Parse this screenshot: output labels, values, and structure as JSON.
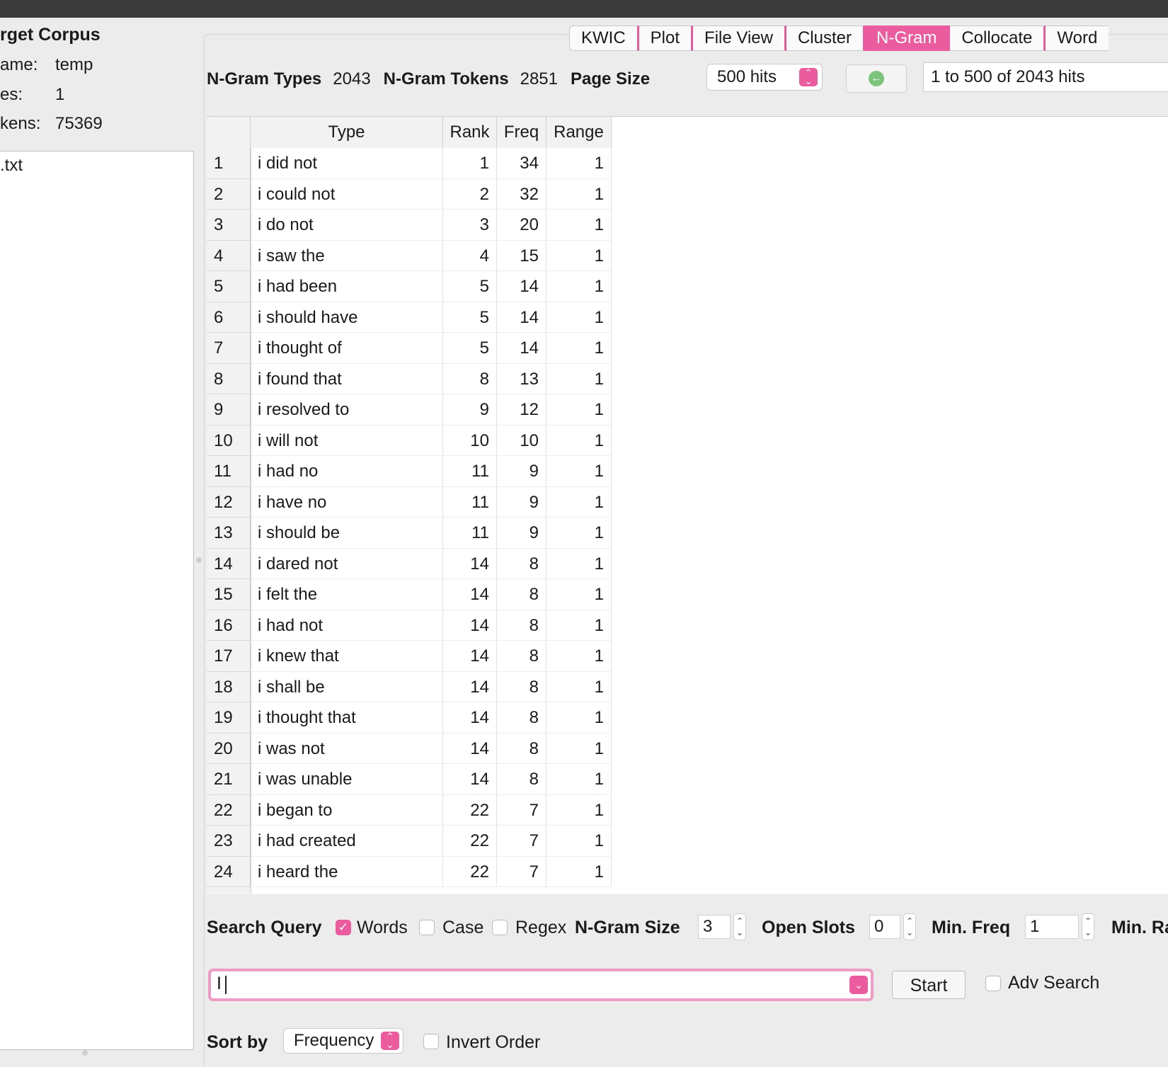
{
  "left_panel": {
    "title": "rget Corpus",
    "name_label": "ame:",
    "name_value": "temp",
    "files_label": "es:",
    "files_value": "1",
    "tokens_label": "kens:",
    "tokens_value": "75369",
    "files": [
      ".txt"
    ]
  },
  "tabs": [
    "KWIC",
    "Plot",
    "File View",
    "Cluster",
    "N-Gram",
    "Collocate",
    "Word"
  ],
  "active_tab": "N-Gram",
  "stats": {
    "types_label": "N-Gram Types",
    "types_value": "2043",
    "tokens_label": "N-Gram Tokens",
    "tokens_value": "2851",
    "page_size_label": "Page Size",
    "page_size_value": "500 hits",
    "range_text": "1 to 500 of 2043 hits"
  },
  "table": {
    "headers": [
      "Type",
      "Rank",
      "Freq",
      "Range"
    ],
    "rows": [
      [
        "1",
        "i did not",
        "1",
        "34",
        "1"
      ],
      [
        "2",
        "i could not",
        "2",
        "32",
        "1"
      ],
      [
        "3",
        "i do not",
        "3",
        "20",
        "1"
      ],
      [
        "4",
        "i saw the",
        "4",
        "15",
        "1"
      ],
      [
        "5",
        "i had been",
        "5",
        "14",
        "1"
      ],
      [
        "6",
        "i should have",
        "5",
        "14",
        "1"
      ],
      [
        "7",
        "i thought of",
        "5",
        "14",
        "1"
      ],
      [
        "8",
        "i found that",
        "8",
        "13",
        "1"
      ],
      [
        "9",
        "i resolved to",
        "9",
        "12",
        "1"
      ],
      [
        "10",
        "i will not",
        "10",
        "10",
        "1"
      ],
      [
        "11",
        "i had no",
        "11",
        "9",
        "1"
      ],
      [
        "12",
        "i have no",
        "11",
        "9",
        "1"
      ],
      [
        "13",
        "i should be",
        "11",
        "9",
        "1"
      ],
      [
        "14",
        "i dared not",
        "14",
        "8",
        "1"
      ],
      [
        "15",
        "i felt the",
        "14",
        "8",
        "1"
      ],
      [
        "16",
        "i had not",
        "14",
        "8",
        "1"
      ],
      [
        "17",
        "i knew that",
        "14",
        "8",
        "1"
      ],
      [
        "18",
        "i shall be",
        "14",
        "8",
        "1"
      ],
      [
        "19",
        "i thought that",
        "14",
        "8",
        "1"
      ],
      [
        "20",
        "i was not",
        "14",
        "8",
        "1"
      ],
      [
        "21",
        "i was unable",
        "14",
        "8",
        "1"
      ],
      [
        "22",
        "i began to",
        "22",
        "7",
        "1"
      ],
      [
        "23",
        "i had created",
        "22",
        "7",
        "1"
      ],
      [
        "24",
        "i heard the",
        "22",
        "7",
        "1"
      ]
    ]
  },
  "search": {
    "query_label": "Search Query",
    "words_label": "Words",
    "words_checked": true,
    "case_label": "Case",
    "case_checked": false,
    "regex_label": "Regex",
    "regex_checked": false,
    "ngram_size_label": "N-Gram Size",
    "ngram_size_value": "3",
    "open_slots_label": "Open Slots",
    "open_slots_value": "0",
    "min_freq_label": "Min. Freq",
    "min_freq_value": "1",
    "min_range_label": "Min. Ra",
    "query_value": "I",
    "start_label": "Start",
    "adv_search_label": "Adv Search",
    "adv_search_checked": false
  },
  "sort": {
    "label": "Sort by",
    "value": "Frequency",
    "invert_label": "Invert Order",
    "invert_checked": false
  },
  "colors": {
    "accent": "#ea5c9e",
    "titlebar": "#3a3a3a"
  }
}
